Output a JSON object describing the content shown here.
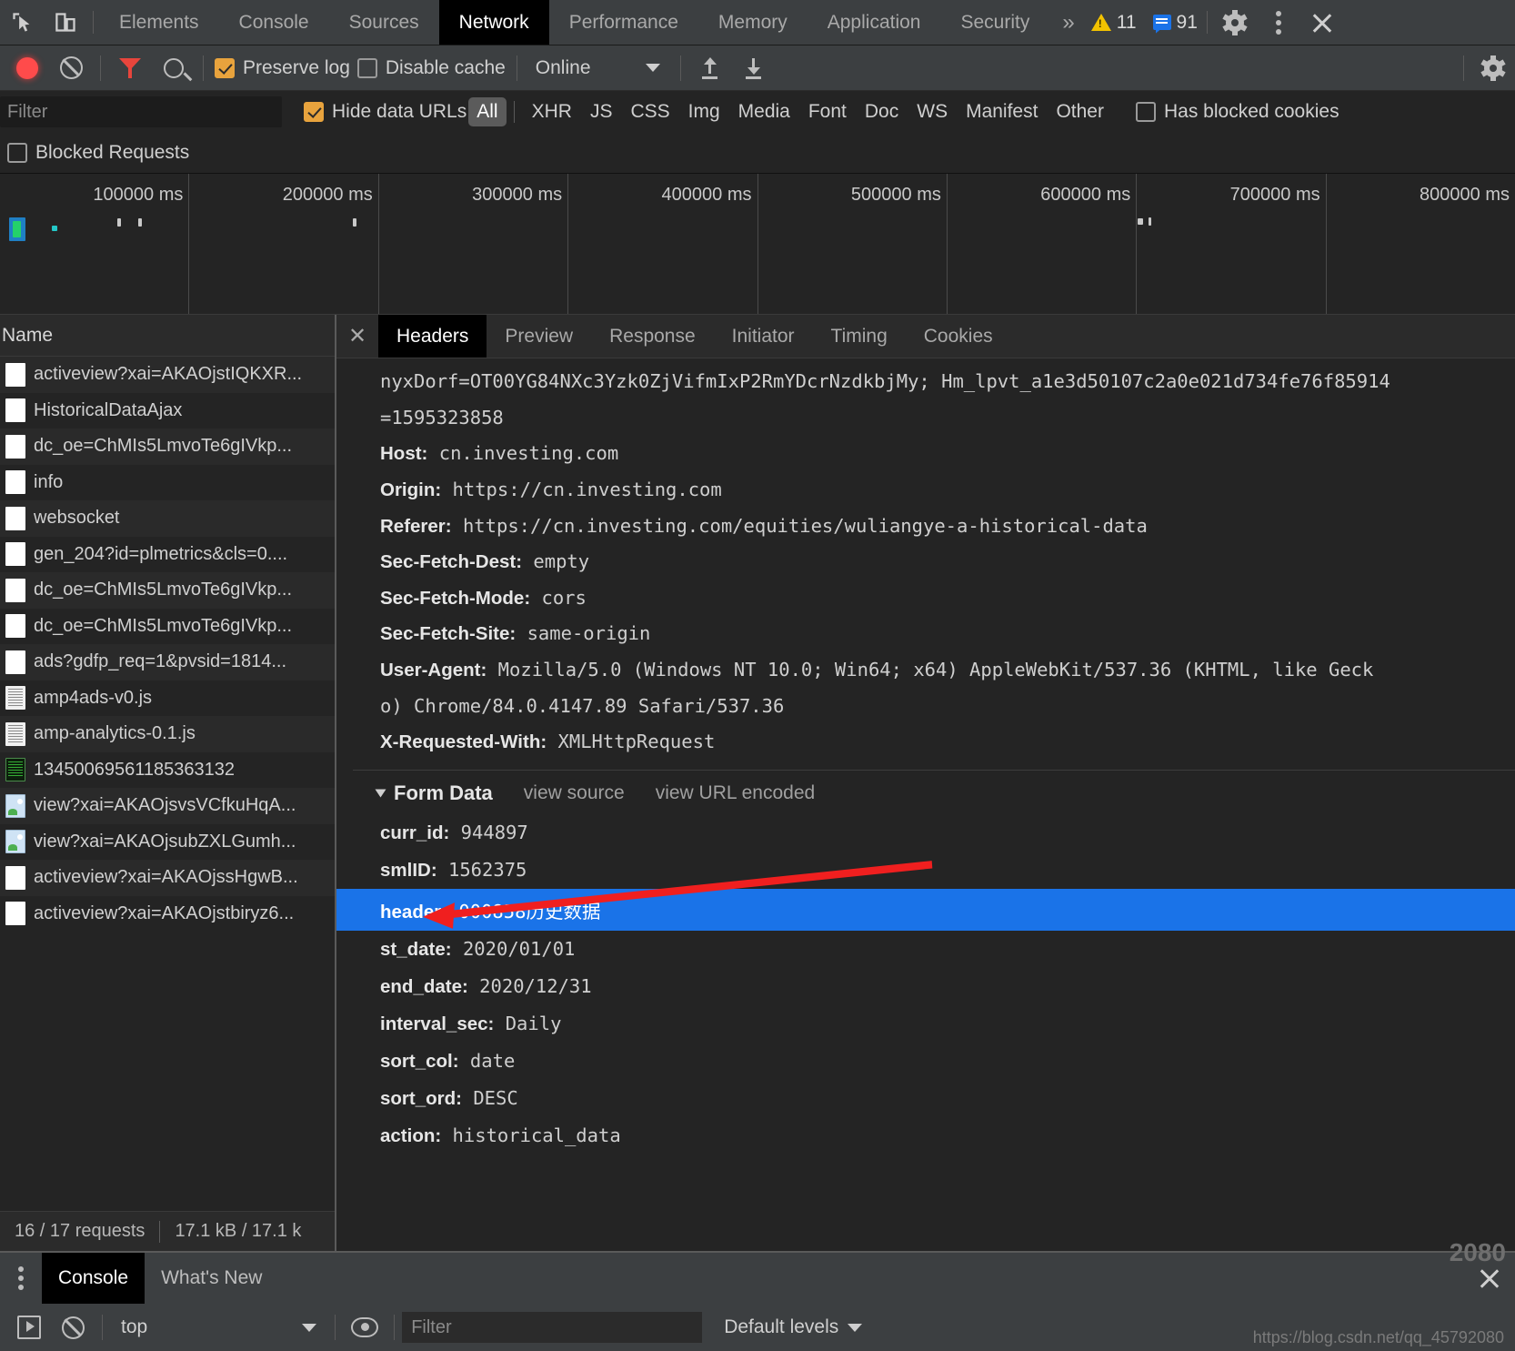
{
  "main_tabs": [
    {
      "label": "Elements",
      "active": false
    },
    {
      "label": "Console",
      "active": false
    },
    {
      "label": "Sources",
      "active": false
    },
    {
      "label": "Network",
      "active": true
    },
    {
      "label": "Performance",
      "active": false
    },
    {
      "label": "Memory",
      "active": false
    },
    {
      "label": "Application",
      "active": false
    },
    {
      "label": "Security",
      "active": false
    }
  ],
  "main_tabbar": {
    "more_label": "»",
    "warning_count": "11",
    "message_count": "91",
    "inspect_icon": "inspect-cursor-icon",
    "device_icon": "device-toolbar-icon",
    "settings_icon": "gear-icon",
    "more_icon": "kebab-menu-icon",
    "close_icon": "close-icon"
  },
  "net_toolbar": {
    "record_label": "record-button",
    "clear_label": "clear-button",
    "filter_icon": "funnel-icon",
    "search_icon": "search-icon",
    "preserve_log": {
      "label": "Preserve log",
      "checked": true
    },
    "disable_cache": {
      "label": "Disable cache",
      "checked": false
    },
    "throttle_value": "Online",
    "import_icon": "import-har-icon",
    "export_icon": "export-har-icon",
    "settings_icon": "gear-icon"
  },
  "filter_bar": {
    "filter_placeholder": "Filter",
    "filter_value": "",
    "hide_data_urls": {
      "label": "Hide data URLs",
      "checked": true
    },
    "types": [
      "All",
      "XHR",
      "JS",
      "CSS",
      "Img",
      "Media",
      "Font",
      "Doc",
      "WS",
      "Manifest",
      "Other"
    ],
    "selected_type": "All",
    "has_blocked_cookies": {
      "label": "Has blocked cookies",
      "checked": false
    },
    "blocked_requests": {
      "label": "Blocked Requests",
      "checked": false
    }
  },
  "overview": {
    "ticks": [
      "100000 ms",
      "200000 ms",
      "300000 ms",
      "400000 ms",
      "500000 ms",
      "600000 ms",
      "700000 ms",
      "800000 ms"
    ]
  },
  "requests": {
    "column_header": "Name",
    "items": [
      {
        "name": "activeview?xai=AKAOjstIQKXR...",
        "icon": "plain-document-icon"
      },
      {
        "name": "HistoricalDataAjax",
        "icon": "plain-document-icon"
      },
      {
        "name": "dc_oe=ChMIs5LmvoTe6gIVkp...",
        "icon": "plain-document-icon"
      },
      {
        "name": "info",
        "icon": "plain-document-icon"
      },
      {
        "name": "websocket",
        "icon": "plain-document-icon"
      },
      {
        "name": "gen_204?id=plmetrics&cls=0....",
        "icon": "plain-document-icon"
      },
      {
        "name": "dc_oe=ChMIs5LmvoTe6gIVkp...",
        "icon": "plain-document-icon"
      },
      {
        "name": "dc_oe=ChMIs5LmvoTe6gIVkp...",
        "icon": "plain-document-icon"
      },
      {
        "name": "ads?gdfp_req=1&pvsid=1814...",
        "icon": "plain-document-icon"
      },
      {
        "name": "amp4ads-v0.js",
        "icon": "script-icon"
      },
      {
        "name": "amp-analytics-0.1.js",
        "icon": "script-icon"
      },
      {
        "name": "13450069561185363132",
        "icon": "dark-document-icon"
      },
      {
        "name": "view?xai=AKAOjsvsVCfkuHqA...",
        "icon": "image-icon"
      },
      {
        "name": "view?xai=AKAOjsubZXLGumh...",
        "icon": "image-icon"
      },
      {
        "name": "activeview?xai=AKAOjssHgwB...",
        "icon": "plain-document-icon"
      },
      {
        "name": "activeview?xai=AKAOjstbiryz6...",
        "icon": "plain-document-icon"
      }
    ],
    "status_requests": "16 / 17 requests",
    "status_transferred": "17.1 kB / 17.1 k"
  },
  "detail": {
    "tabs": [
      {
        "label": "Headers",
        "active": true
      },
      {
        "label": "Preview",
        "active": false
      },
      {
        "label": "Response",
        "active": false
      },
      {
        "label": "Initiator",
        "active": false
      },
      {
        "label": "Timing",
        "active": false
      },
      {
        "label": "Cookies",
        "active": false
      }
    ],
    "close_icon": "close-icon",
    "headers": [
      {
        "key": "",
        "value": "nyxDorf=OT00YG84NXc3Yzk0ZjVifmIxP2RmYDcrNzdkbjMy; Hm_lpvt_a1e3d50107c2a0e021d734fe76f85914"
      },
      {
        "key": "",
        "value": "=1595323858"
      },
      {
        "key": "Host:",
        "value": "cn.investing.com"
      },
      {
        "key": "Origin:",
        "value": "https://cn.investing.com"
      },
      {
        "key": "Referer:",
        "value": "https://cn.investing.com/equities/wuliangye-a-historical-data"
      },
      {
        "key": "Sec-Fetch-Dest:",
        "value": "empty"
      },
      {
        "key": "Sec-Fetch-Mode:",
        "value": "cors"
      },
      {
        "key": "Sec-Fetch-Site:",
        "value": "same-origin"
      },
      {
        "key": "User-Agent:",
        "value": "Mozilla/5.0 (Windows NT 10.0; Win64; x64) AppleWebKit/537.36 (KHTML, like Geck"
      },
      {
        "key": "",
        "value": "o) Chrome/84.0.4147.89 Safari/537.36"
      },
      {
        "key": "X-Requested-With:",
        "value": "XMLHttpRequest"
      }
    ],
    "form_data": {
      "title": "Form Data",
      "view_source": "view source",
      "view_url_encoded": "view URL encoded",
      "rows": [
        {
          "key": "curr_id:",
          "value": "944897",
          "highlighted": false
        },
        {
          "key": "smlID:",
          "value": "1562375",
          "highlighted": false
        },
        {
          "key": "header:",
          "value": "000858历史数据",
          "highlighted": true
        },
        {
          "key": "st_date:",
          "value": "2020/01/01",
          "highlighted": false
        },
        {
          "key": "end_date:",
          "value": "2020/12/31",
          "highlighted": false
        },
        {
          "key": "interval_sec:",
          "value": "Daily",
          "highlighted": false
        },
        {
          "key": "sort_col:",
          "value": "date",
          "highlighted": false
        },
        {
          "key": "sort_ord:",
          "value": "DESC",
          "highlighted": false
        },
        {
          "key": "action:",
          "value": "historical_data",
          "highlighted": false
        }
      ]
    }
  },
  "drawer": {
    "tabs": [
      {
        "label": "Console",
        "active": true
      },
      {
        "label": "What's New",
        "active": false
      }
    ],
    "menu_icon": "kebab-menu-icon",
    "close_icon": "close-icon",
    "execute_icon": "execute-context-icon",
    "clear_icon": "clear-console-icon",
    "context_value": "top",
    "eye_icon": "live-expression-icon",
    "filter_placeholder": "Filter",
    "filter_value": "",
    "levels_label": "Default levels"
  },
  "watermark": {
    "url": "https://blog.csdn.net/qq_45792080",
    "tag": "2080"
  },
  "colors": {
    "accent_blue": "#1a73e8",
    "checkbox_orange": "#e8a33d",
    "record_red": "#ff4b4b",
    "annotation_red": "#f01f1f",
    "warning_yellow": "#f2c200"
  }
}
